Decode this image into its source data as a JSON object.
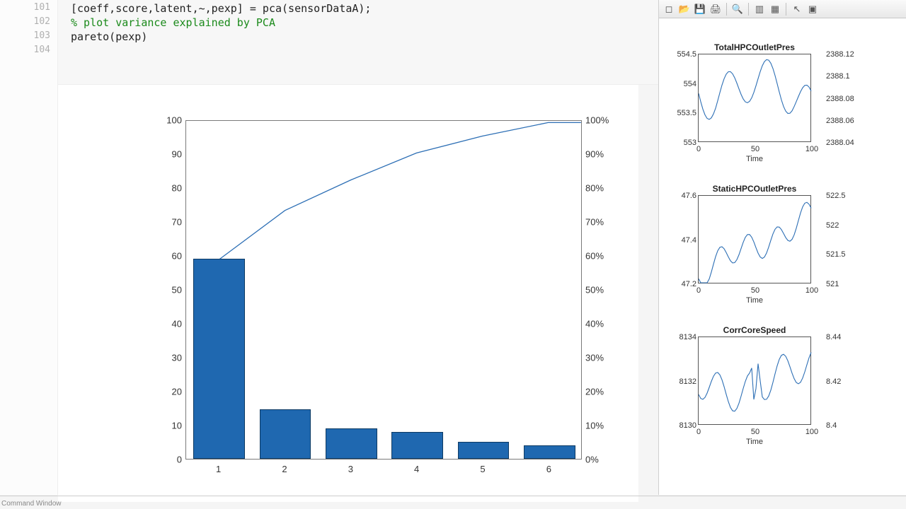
{
  "editor": {
    "lines": [
      {
        "num": "101",
        "text": "[coeff,score,latent,~,pexp] = pca(sensorDataA);",
        "cls": ""
      },
      {
        "num": "102",
        "text": "",
        "cls": ""
      },
      {
        "num": "103",
        "text": "% plot variance explained by PCA",
        "cls": "comment"
      },
      {
        "num": "104",
        "text": "pareto(pexp)",
        "cls": ""
      }
    ]
  },
  "chart_data": {
    "type": "pareto",
    "categories": [
      "1",
      "2",
      "3",
      "4",
      "5",
      "6"
    ],
    "values": [
      59,
      14.5,
      9,
      8,
      5,
      4
    ],
    "cumulative": [
      59,
      73.5,
      82.5,
      90.5,
      95.5,
      99.5
    ],
    "y_left_ticks": [
      "0",
      "10",
      "20",
      "30",
      "40",
      "50",
      "60",
      "70",
      "80",
      "90",
      "100"
    ],
    "y_right_ticks": [
      "0%",
      "10%",
      "20%",
      "30%",
      "40%",
      "50%",
      "60%",
      "70%",
      "80%",
      "90%",
      "100%"
    ],
    "ylim": [
      0,
      100
    ]
  },
  "right_figures": {
    "toolbar_icons": [
      "new",
      "open",
      "save",
      "print",
      "zoom",
      "data1",
      "data2",
      "pointer",
      "figprops"
    ],
    "charts": [
      {
        "title": "TotalHPCOutletPres",
        "y_ticks": [
          "553",
          "553.5",
          "554",
          "554.5"
        ],
        "y2_ticks": [
          "2388.04",
          "2388.06",
          "2388.08",
          "2388.1",
          "2388.12"
        ],
        "x_ticks": [
          "0",
          "50",
          "100"
        ],
        "xlabel": "Time"
      },
      {
        "title": "StaticHPCOutletPres",
        "y_ticks": [
          "47.2",
          "47.4",
          "47.6"
        ],
        "y2_ticks": [
          "521",
          "521.5",
          "522",
          "522.5"
        ],
        "x_ticks": [
          "0",
          "50",
          "100"
        ],
        "xlabel": "Time"
      },
      {
        "title": "CorrCoreSpeed",
        "y_ticks": [
          "8130",
          "8132",
          "8134"
        ],
        "y2_ticks": [
          "8.4",
          "8.42",
          "8.44"
        ],
        "x_ticks": [
          "0",
          "50",
          "100"
        ],
        "xlabel": "Time"
      }
    ]
  },
  "footer": "Command Window"
}
